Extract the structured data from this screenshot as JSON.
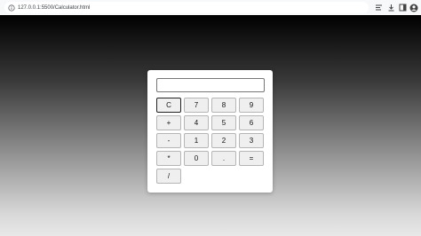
{
  "browser": {
    "url": "127.0.0.1:5500/Calculator.html",
    "icons": [
      "info-icon",
      "reader-icon",
      "download-icon",
      "sidebar-icon",
      "profile-icon"
    ]
  },
  "calculator": {
    "display_value": "",
    "buttons": [
      {
        "label": "C",
        "name": "clear-button",
        "focused": true
      },
      {
        "label": "7",
        "name": "seven-button"
      },
      {
        "label": "8",
        "name": "eight-button"
      },
      {
        "label": "9",
        "name": "nine-button"
      },
      {
        "label": "+",
        "name": "plus-button"
      },
      {
        "label": "4",
        "name": "four-button"
      },
      {
        "label": "5",
        "name": "five-button"
      },
      {
        "label": "6",
        "name": "six-button"
      },
      {
        "label": "-",
        "name": "minus-button"
      },
      {
        "label": "1",
        "name": "one-button"
      },
      {
        "label": "2",
        "name": "two-button"
      },
      {
        "label": "3",
        "name": "three-button"
      },
      {
        "label": "*",
        "name": "multiply-button"
      },
      {
        "label": "0",
        "name": "zero-button"
      },
      {
        "label": ".",
        "name": "decimal-button"
      },
      {
        "label": "=",
        "name": "equals-button"
      },
      {
        "label": "/",
        "name": "divide-button"
      }
    ]
  }
}
